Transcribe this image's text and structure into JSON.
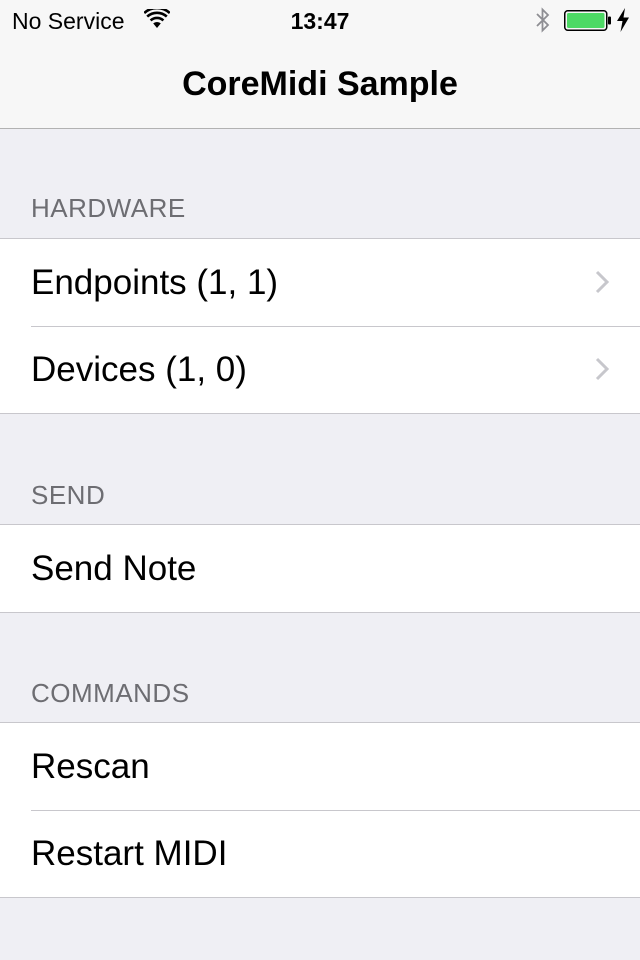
{
  "status_bar": {
    "carrier": "No Service",
    "time": "13:47"
  },
  "nav": {
    "title": "CoreMidi Sample"
  },
  "sections": {
    "hardware": {
      "header": "HARDWARE",
      "items": [
        {
          "label": "Endpoints (1, 1)"
        },
        {
          "label": "Devices (1, 0)"
        }
      ]
    },
    "send": {
      "header": "SEND",
      "items": [
        {
          "label": "Send Note"
        }
      ]
    },
    "commands": {
      "header": "COMMANDS",
      "items": [
        {
          "label": "Rescan"
        },
        {
          "label": "Restart MIDI"
        }
      ]
    }
  },
  "colors": {
    "background": "#efeff4",
    "header_text": "#6d6d72",
    "separator": "#c8c7cc",
    "battery_fill": "#4cd964"
  },
  "battery_level": 1.0,
  "icons": [
    "wifi-icon",
    "bluetooth-icon",
    "battery-icon",
    "charging-bolt-icon",
    "chevron-right-icon"
  ]
}
